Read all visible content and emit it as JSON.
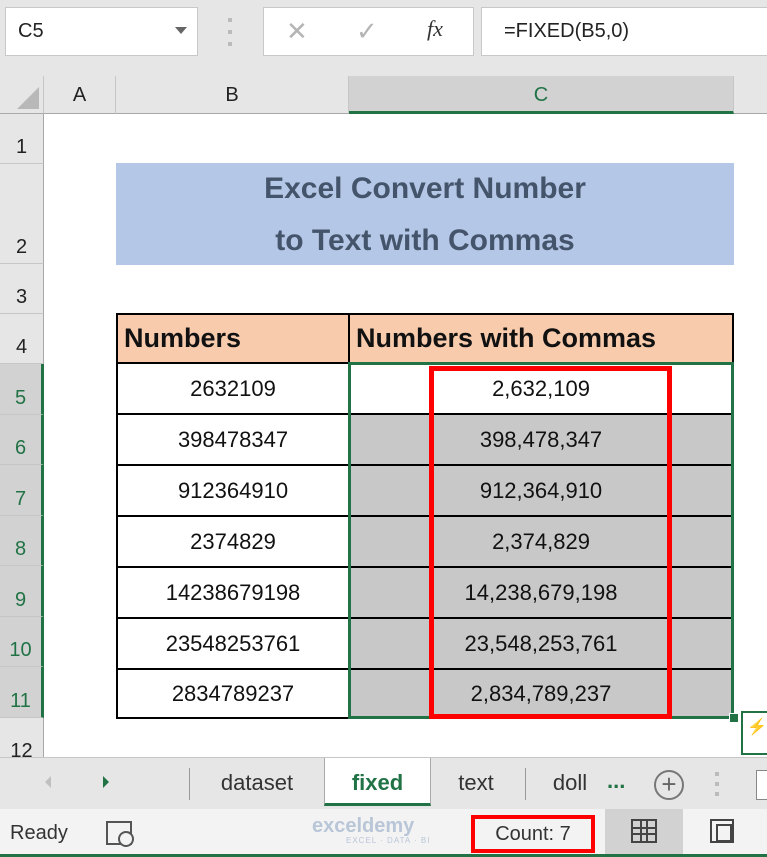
{
  "formula_bar": {
    "name_box": "C5",
    "cancel_icon": "✕",
    "enter_icon": "✓",
    "fx_label": "fx",
    "formula": "=FIXED(B5,0)"
  },
  "columns": [
    "A",
    "B",
    "C"
  ],
  "selected_column": "C",
  "rows": [
    "1",
    "2",
    "3",
    "4",
    "5",
    "6",
    "7",
    "8",
    "9",
    "10",
    "11",
    "12"
  ],
  "title": {
    "line1": "Excel Convert Number",
    "line2": "to Text with Commas",
    "bg_color": "#b4c7e7"
  },
  "table": {
    "headers": [
      "Numbers",
      "Numbers with Commas"
    ],
    "header_bg": "#f8cbad",
    "rows": [
      [
        "2632109",
        "2,632,109"
      ],
      [
        "398478347",
        "398,478,347"
      ],
      [
        "912364910",
        "912,364,910"
      ],
      [
        "2374829",
        "2,374,829"
      ],
      [
        "14238679198",
        "14,238,679,198"
      ],
      [
        "23548253761",
        "23,548,253,761"
      ],
      [
        "2834789237",
        "2,834,789,237"
      ]
    ]
  },
  "sheet_tabs": {
    "tabs": [
      "dataset",
      "fixed",
      "text",
      "doll"
    ],
    "active": "fixed",
    "more": "...",
    "add_icon": "+"
  },
  "status_bar": {
    "ready": "Ready",
    "watermark": "exceldemy",
    "watermark_sub": "EXCEL · DATA · BI",
    "count": "Count: 7"
  },
  "accent_color": "#217346",
  "highlight_color": "#ff0000"
}
